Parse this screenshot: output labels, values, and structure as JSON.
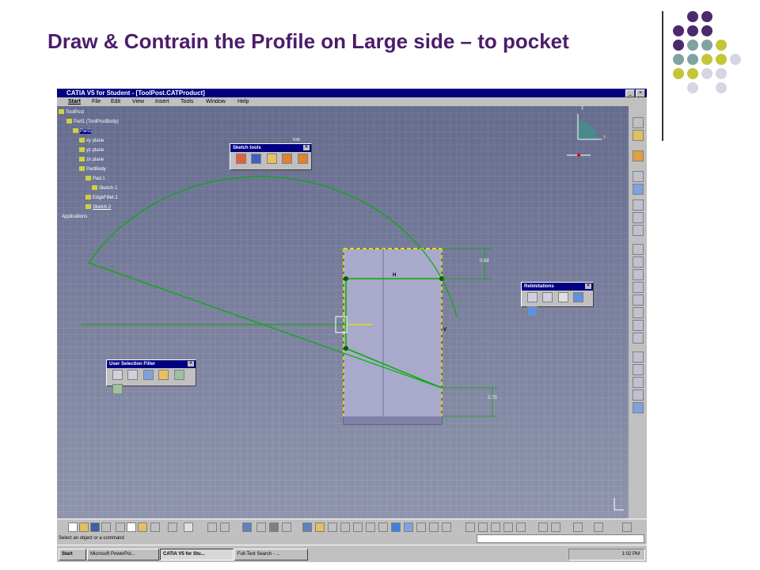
{
  "slide": {
    "title": "Draw & Contrain the Profile on Large side – to pocket",
    "palette": {
      "purple": "#4b2a6b",
      "teal": "#7fa3a0",
      "olive": "#c3c637",
      "lavender": "#d7d4e4"
    }
  },
  "window": {
    "title": "CATIA V5 for Student - [ToolPost.CATProduct]",
    "menu": [
      "Start",
      "File",
      "Edit",
      "View",
      "Insert",
      "Tools",
      "Window",
      "Help"
    ]
  },
  "tree": {
    "items": [
      "ToolPost",
      "Part1 (ToolPostBody)",
      "Part1",
      "xy plane",
      "yz plane",
      "zx plane",
      "PartBody",
      "Pad.1",
      "Sketch.1",
      "EdgeFillet.1",
      "Sketch.2",
      "Applications"
    ]
  },
  "toolbars": {
    "sketch_tools": "Sketch tools",
    "relimitations": "Relimitations",
    "user_selection_filter": "User Selection Filter"
  },
  "sketch": {
    "dimension_top": "0.88",
    "dimension_bottom": "0.75",
    "radius_label": "R45",
    "constraint_h": "H",
    "constraint_v": "V"
  },
  "compass": {
    "z": "z",
    "y": "y"
  },
  "status": {
    "text": "Select an object or a command"
  },
  "taskbar": {
    "start": "Start",
    "buttons": [
      "Microsoft PowerPoi...",
      "CATIA V5 for Stu...",
      "Full-Text Search - ..."
    ],
    "clock": "1:02 PM"
  },
  "colors": {
    "sketch_green": "#00b000",
    "sketch_yellow": "#e0e000",
    "part_fill": "#a9a9cc"
  }
}
